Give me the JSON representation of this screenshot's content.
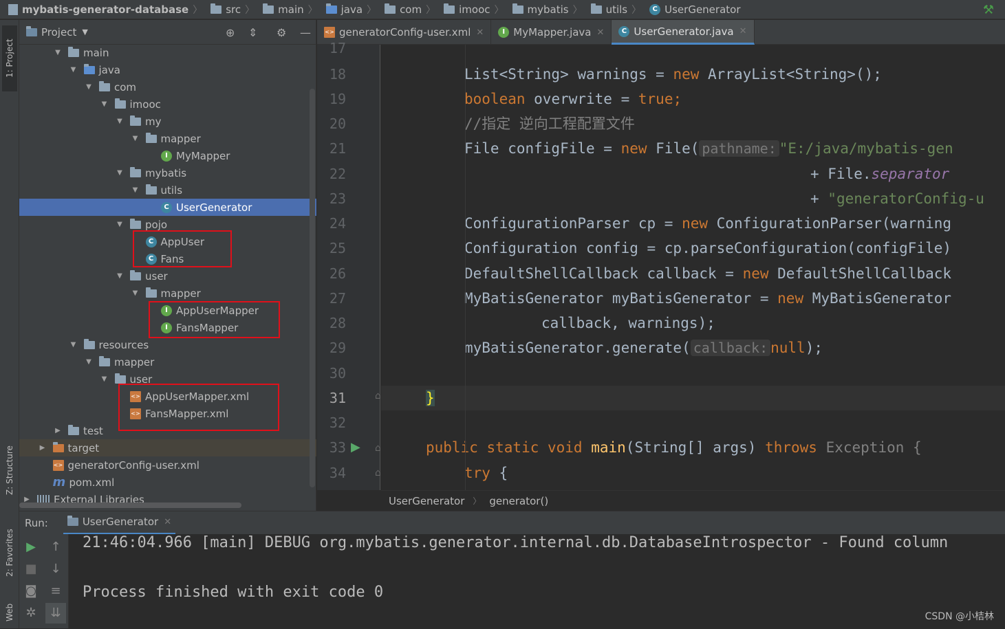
{
  "breadcrumb": {
    "project": "mybatis-generator-database",
    "items": [
      "src",
      "main",
      "java",
      "com",
      "imooc",
      "mybatis",
      "utils"
    ],
    "file": "UserGenerator"
  },
  "side_tabs": {
    "project": "1: Project",
    "structure": "Z: Structure",
    "favorites": "2: Favorites",
    "web": "Web"
  },
  "project_panel": {
    "title": "Project",
    "tree": [
      {
        "label": "main",
        "type": "folder",
        "depth": 2,
        "arrow": "▼"
      },
      {
        "label": "java",
        "type": "folder-src",
        "depth": 3,
        "arrow": "▼"
      },
      {
        "label": "com",
        "type": "folder",
        "depth": 4,
        "arrow": "▼"
      },
      {
        "label": "imooc",
        "type": "folder",
        "depth": 5,
        "arrow": "▼"
      },
      {
        "label": "my",
        "type": "folder",
        "depth": 6,
        "arrow": "▼"
      },
      {
        "label": "mapper",
        "type": "folder",
        "depth": 7,
        "arrow": "▼"
      },
      {
        "label": "MyMapper",
        "type": "interface",
        "depth": 8
      },
      {
        "label": "mybatis",
        "type": "folder",
        "depth": 6,
        "arrow": "▼"
      },
      {
        "label": "utils",
        "type": "folder",
        "depth": 7,
        "arrow": "▼"
      },
      {
        "label": "UserGenerator",
        "type": "class",
        "depth": 8,
        "selected": true
      },
      {
        "label": "pojo",
        "type": "folder",
        "depth": 6,
        "arrow": "▼"
      },
      {
        "label": "AppUser",
        "type": "class",
        "depth": 7
      },
      {
        "label": "Fans",
        "type": "class",
        "depth": 7
      },
      {
        "label": "user",
        "type": "folder",
        "depth": 6,
        "arrow": "▼"
      },
      {
        "label": "mapper",
        "type": "folder",
        "depth": 7,
        "arrow": "▼"
      },
      {
        "label": "AppUserMapper",
        "type": "interface",
        "depth": 8
      },
      {
        "label": "FansMapper",
        "type": "interface",
        "depth": 8
      },
      {
        "label": "resources",
        "type": "folder",
        "depth": 3,
        "arrow": "▼"
      },
      {
        "label": "mapper",
        "type": "folder",
        "depth": 4,
        "arrow": "▼"
      },
      {
        "label": "user",
        "type": "folder",
        "depth": 5,
        "arrow": "▼"
      },
      {
        "label": "AppUserMapper.xml",
        "type": "xml",
        "depth": 6
      },
      {
        "label": "FansMapper.xml",
        "type": "xml",
        "depth": 6
      },
      {
        "label": "test",
        "type": "folder",
        "depth": 2,
        "arrow": "▶"
      },
      {
        "label": "target",
        "type": "folder-target",
        "depth": 1,
        "arrow": "▶",
        "highlight": true
      },
      {
        "label": "generatorConfig-user.xml",
        "type": "xml",
        "depth": 1
      },
      {
        "label": "pom.xml",
        "type": "maven",
        "depth": 1
      },
      {
        "label": "External Libraries",
        "type": "lib",
        "depth": 0,
        "arrow": "▶"
      }
    ]
  },
  "editor": {
    "tabs": [
      {
        "label": "generatorConfig-user.xml",
        "type": "xml"
      },
      {
        "label": "MyMapper.java",
        "type": "interface"
      },
      {
        "label": "UserGenerator.java",
        "type": "class",
        "active": true
      }
    ],
    "line_numbers": [
      "17",
      "18",
      "19",
      "20",
      "21",
      "22",
      "23",
      "24",
      "25",
      "26",
      "27",
      "28",
      "29",
      "30",
      "31",
      "32",
      "33",
      "34"
    ],
    "current_line": "31",
    "breadcrumb": [
      "UserGenerator",
      "generator()"
    ]
  },
  "code": {
    "l18": {
      "a": "List<String> warnings = ",
      "b": "new",
      "c": " ArrayList<String>();"
    },
    "l19": {
      "a": "boolean",
      "b": " overwrite = ",
      "c": "true;"
    },
    "l20": "//指定 逆向工程配置文件",
    "l21": {
      "a": "File configFile = ",
      "b": "new",
      "c": " File(",
      "hint": "pathname:",
      "d": "\"E:/java/mybatis-gen"
    },
    "l22": {
      "a": "+ File.",
      "b": "separator"
    },
    "l23": {
      "a": "+ ",
      "b": "\"generatorConfig-u"
    },
    "l24": {
      "a": "ConfigurationParser cp = ",
      "b": "new",
      "c": " ConfigurationParser(warning"
    },
    "l25": "Configuration config = cp.parseConfiguration(configFile)",
    "l26": {
      "a": "DefaultShellCallback callback = ",
      "b": "new",
      "c": " DefaultShellCallback"
    },
    "l27": {
      "a": "MyBatisGenerator myBatisGenerator = ",
      "b": "new",
      "c": " MyBatisGenerator"
    },
    "l28": {
      "a": "callback, warnings);"
    },
    "l29": {
      "a": "myBatisGenerator.generate(",
      "hint": "callback:",
      "b": "null",
      "c": ");"
    },
    "l31": "}",
    "l33": {
      "a": "public static void ",
      "b": "main",
      "c": "(String[] args) ",
      "d": "throws",
      "e": " Exception {"
    },
    "l34": {
      "a": "try",
      "b": " {"
    }
  },
  "run": {
    "label": "Run:",
    "tab": "UserGenerator",
    "console": [
      "21:46:04.966 [main] DEBUG org.mybatis.generator.internal.db.DatabaseIntrospector - Found column",
      "",
      "Process finished with exit code 0"
    ]
  },
  "watermark": "CSDN @小桔林"
}
